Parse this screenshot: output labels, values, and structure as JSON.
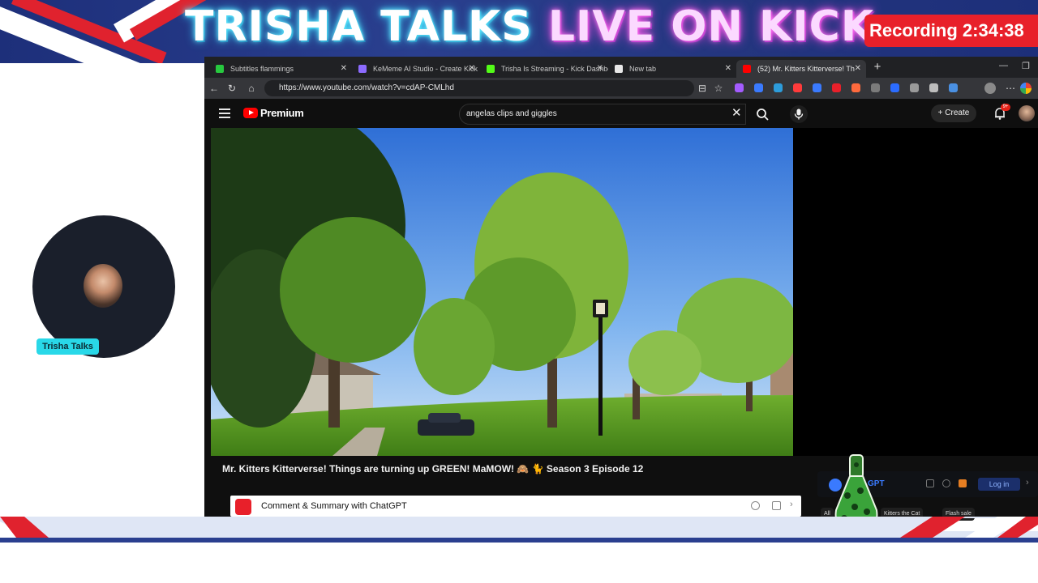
{
  "overlay": {
    "banner_title_part1": "TRISHA TALKS",
    "banner_title_part2": "LIVE ON KICK",
    "recording_label": "Recording",
    "recording_time": "2:34:38",
    "streamer_tag": "Trisha Talks",
    "colors": {
      "banner_blue": "#24367f",
      "banner_red": "#e0222e",
      "recording_red": "#e8202a",
      "name_tag": "#29d8e8"
    }
  },
  "browser": {
    "tabs": [
      {
        "label": "Subtitles flammings",
        "favicon_color": "#27c93f",
        "active": false
      },
      {
        "label": "KeMeme AI Studio - Create Kick",
        "favicon_color": "#8c6bff",
        "active": false
      },
      {
        "label": "Trisha Is Streaming - Kick Dashboard",
        "favicon_color": "#53fc18",
        "active": false
      },
      {
        "label": "New tab",
        "favicon_color": "#e8e8e8",
        "active": false
      },
      {
        "label": "(52) Mr. Kitters Kitterverse! Th",
        "favicon_color": "#ff0000",
        "active": true
      }
    ],
    "new_tab_symbol": "+",
    "url": "https://www.youtube.com/watch?v=cdAP-CMLhd",
    "extension_colors": [
      "#a45cff",
      "#3a7afe",
      "#2d9cdb",
      "#ff3b3b",
      "#3a7afe",
      "#e8202a",
      "#ff6a3d",
      "#7b7b7b",
      "#2b6cff",
      "#9a9a9a",
      "#bdbdbd",
      "#4a90e2"
    ]
  },
  "youtube": {
    "brand": "Premium",
    "search_query": "angelas clips and giggles",
    "create_label": "Create",
    "notification_count": "9+",
    "video_title": "Mr. Kitters Kitterverse! Things are turning up GREEN! MaMOW! 🙈 🐈 Season 3 Episode 12",
    "extension_bar_label": "Comment & Summary with ChatGPT"
  },
  "gpt_widget": {
    "label": "GPT",
    "login_label": "Log in",
    "chips": [
      "All",
      "Kitters the Cat",
      "Flash sale"
    ]
  }
}
